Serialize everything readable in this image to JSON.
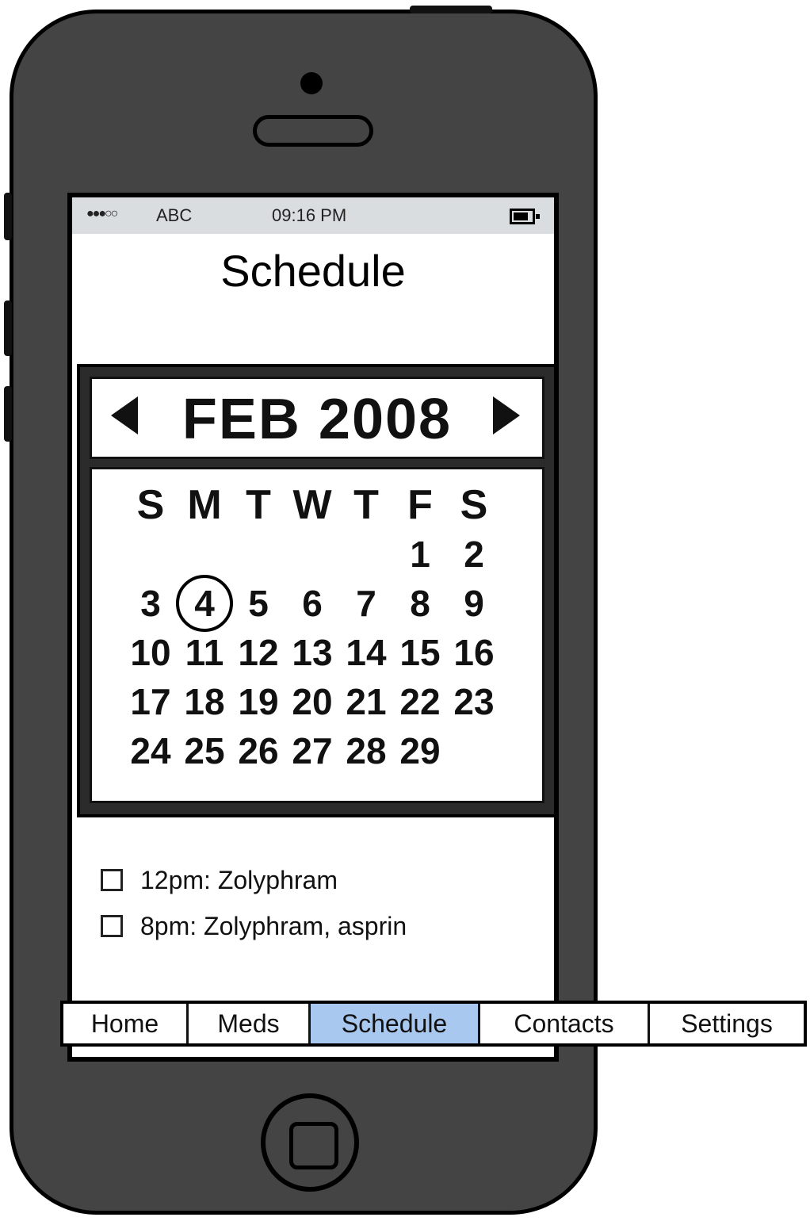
{
  "status_bar": {
    "signal": "●●●○○",
    "carrier": "ABC",
    "time": "09:16 PM",
    "battery_icon": "battery-icon"
  },
  "screen": {
    "title": "Schedule"
  },
  "calendar": {
    "month_label": "FEB 2008",
    "prev_icon": "chevron-left-icon",
    "next_icon": "chevron-right-icon",
    "weekdays": [
      "S",
      "M",
      "T",
      "W",
      "T",
      "F",
      "S"
    ],
    "weeks": [
      [
        "",
        "",
        "",
        "",
        "",
        "1",
        "2"
      ],
      [
        "3",
        "4",
        "5",
        "6",
        "7",
        "8",
        "9"
      ],
      [
        "10",
        "11",
        "12",
        "13",
        "14",
        "15",
        "16"
      ],
      [
        "17",
        "18",
        "19",
        "20",
        "21",
        "22",
        "23"
      ],
      [
        "24",
        "25",
        "26",
        "27",
        "28",
        "29",
        ""
      ]
    ],
    "selected_day": "4"
  },
  "events": [
    {
      "label": "12pm: Zolyphram",
      "checked": false
    },
    {
      "label": "8pm: Zolyphram, asprin",
      "checked": false
    }
  ],
  "tab_bar": {
    "tabs": [
      "Home",
      "Meds",
      "Schedule",
      "Contacts",
      "Settings"
    ],
    "active": "Schedule"
  }
}
